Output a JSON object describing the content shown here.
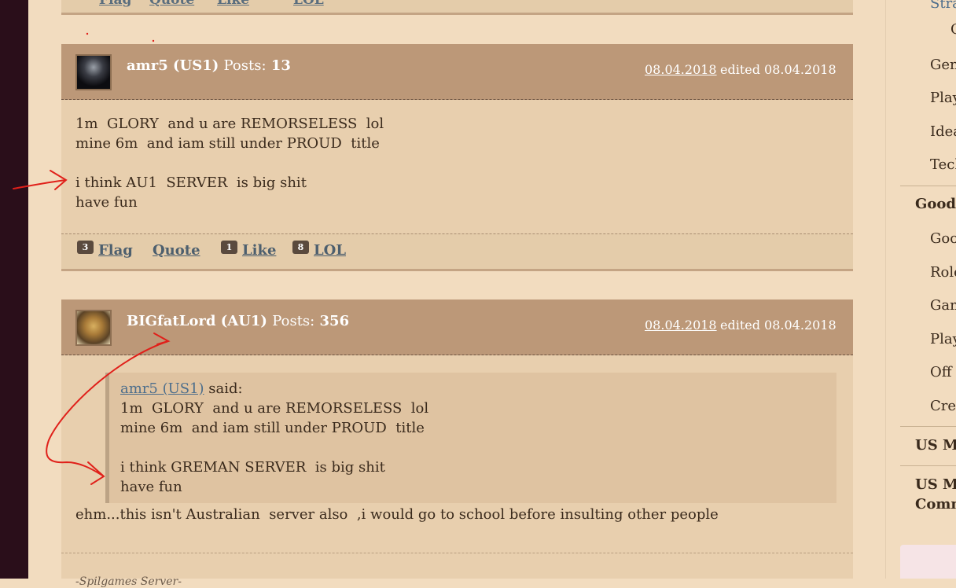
{
  "top_footer": {
    "fragments": [
      "Flag",
      "Quote",
      "Like",
      "LOL"
    ]
  },
  "posts": [
    {
      "author": "amr5 (US1)",
      "posts_label": "Posts:",
      "posts_count": "13",
      "date": "08.04.2018",
      "edited": "edited 08.04.2018",
      "body": [
        "1m  GLORY  and u are REMORSELESS  lol",
        "mine 6m  and iam still under PROUD  title",
        "",
        "i think AU1  SERVER  is big shit",
        "have fun"
      ],
      "footer": {
        "flag_count": "3",
        "flag_label": "Flag",
        "quote_label": "Quote",
        "like_count": "1",
        "like_label": "Like",
        "lol_count": "8",
        "lol_label": "LOL"
      }
    },
    {
      "author": "BIGfatLord (AU1)",
      "posts_label": "Posts:",
      "posts_count": "356",
      "date": "08.04.2018",
      "edited": "edited 08.04.2018",
      "quote": {
        "author": "amr5 (US1)",
        "said": " said:",
        "lines": [
          "1m  GLORY  and u are REMORSELESS  lol",
          "mine 6m  and iam still under PROUD  title",
          "",
          "i think GREMAN SERVER  is big shit",
          "have fun"
        ]
      },
      "body": [
        "ehm...this isn't Australian  server also  ,i would go to school before insulting other people"
      ],
      "signature": "-Spilgames Server-"
    }
  ],
  "sidebar": {
    "items": [
      {
        "label": "Stra",
        "style": "link"
      },
      {
        "label": "G",
        "style": "sub"
      },
      {
        "label": "Gen",
        "style": "item"
      },
      {
        "label": "Play",
        "style": "item"
      },
      {
        "label": "Idea",
        "style": "item"
      },
      {
        "label": "Tech",
        "style": "item"
      },
      {
        "label": "Goodg",
        "style": "bold"
      },
      {
        "label": "Goo",
        "style": "item"
      },
      {
        "label": "Role",
        "style": "item"
      },
      {
        "label": "Gam",
        "style": "item"
      },
      {
        "label": "Play",
        "style": "item"
      },
      {
        "label": "Off T",
        "style": "item"
      },
      {
        "label": "Crea",
        "style": "item"
      },
      {
        "label": "US Mi",
        "style": "bold"
      },
      {
        "label": "US Mi",
        "style": "bold"
      },
      {
        "label": "Comm",
        "style": "bold"
      }
    ]
  },
  "colors": {
    "header": "#bc9878",
    "body": "#e8cfae",
    "annotation": "#e0201a",
    "link": "#4d6e8c"
  }
}
